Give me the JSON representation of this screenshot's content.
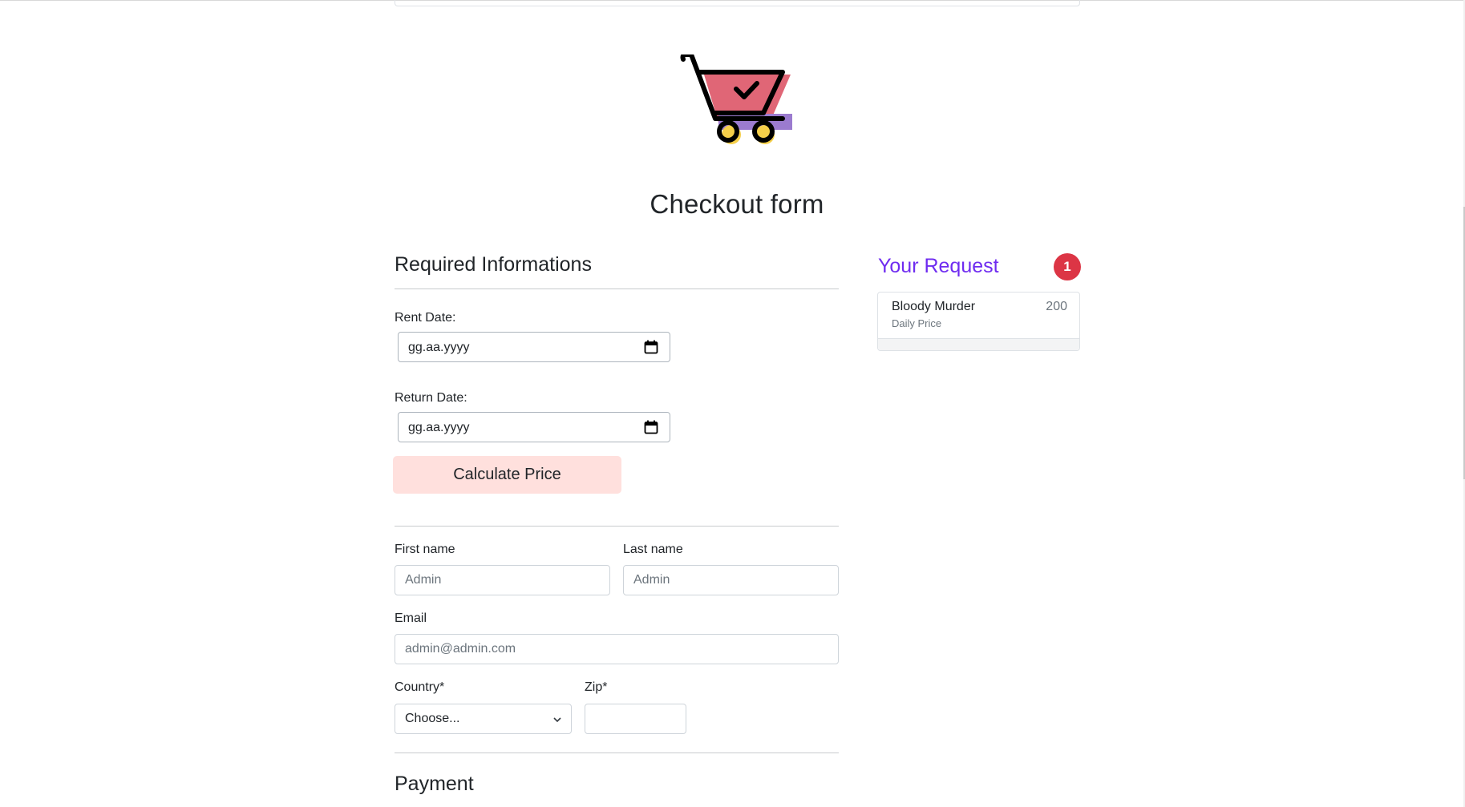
{
  "header": {
    "title": "Checkout form",
    "cart_icon": "shopping-cart-check-icon"
  },
  "required": {
    "title": "Required Informations",
    "rent_date": {
      "label": "Rent Date:",
      "value": "gg.aa.yyyy"
    },
    "return_date": {
      "label": "Return Date:",
      "value": "gg.aa.yyyy"
    },
    "calculate_button": "Calculate Price",
    "calculate_button_color": "#ffe0dd"
  },
  "billing": {
    "first_name": {
      "label": "First name",
      "value": "Admin"
    },
    "last_name": {
      "label": "Last name",
      "value": "Admin"
    },
    "email": {
      "label": "Email",
      "value": "admin@admin.com"
    },
    "country": {
      "label": "Country*",
      "selected": "Choose..."
    },
    "zip": {
      "label": "Zip*",
      "value": ""
    }
  },
  "payment": {
    "title": "Payment"
  },
  "request": {
    "title": "Your Request",
    "title_color": "#6f2cf0",
    "count": "1",
    "count_color": "#dc3545",
    "items": [
      {
        "name": "Bloody Murder",
        "subtitle": "Daily Price",
        "price": "200"
      }
    ]
  }
}
